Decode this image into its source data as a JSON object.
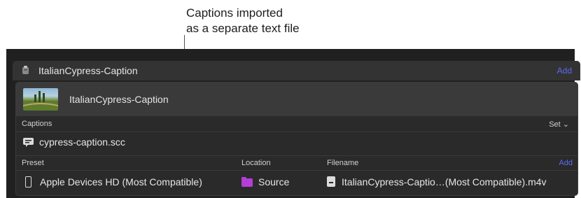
{
  "callout": {
    "line1": "Captions imported",
    "line2": "as a separate text file"
  },
  "library": {
    "title": "ItalianCypress-Caption",
    "add_label": "Add"
  },
  "project": {
    "title": "ItalianCypress-Caption"
  },
  "captions": {
    "section_label": "Captions",
    "set_label": "Set ⌄",
    "file_name": "cypress-caption.scc"
  },
  "destinations": {
    "columns": {
      "preset": "Preset",
      "location": "Location",
      "filename": "Filename",
      "add_label": "Add"
    },
    "rows": [
      {
        "preset": "Apple Devices HD (Most Compatible)",
        "location": "Source",
        "filename": "ItalianCypress-Captio…(Most Compatible).m4v"
      }
    ]
  },
  "colors": {
    "accent_link": "#5b6cf0",
    "folder": "#b43ed6",
    "panel_bg": "#202020"
  }
}
